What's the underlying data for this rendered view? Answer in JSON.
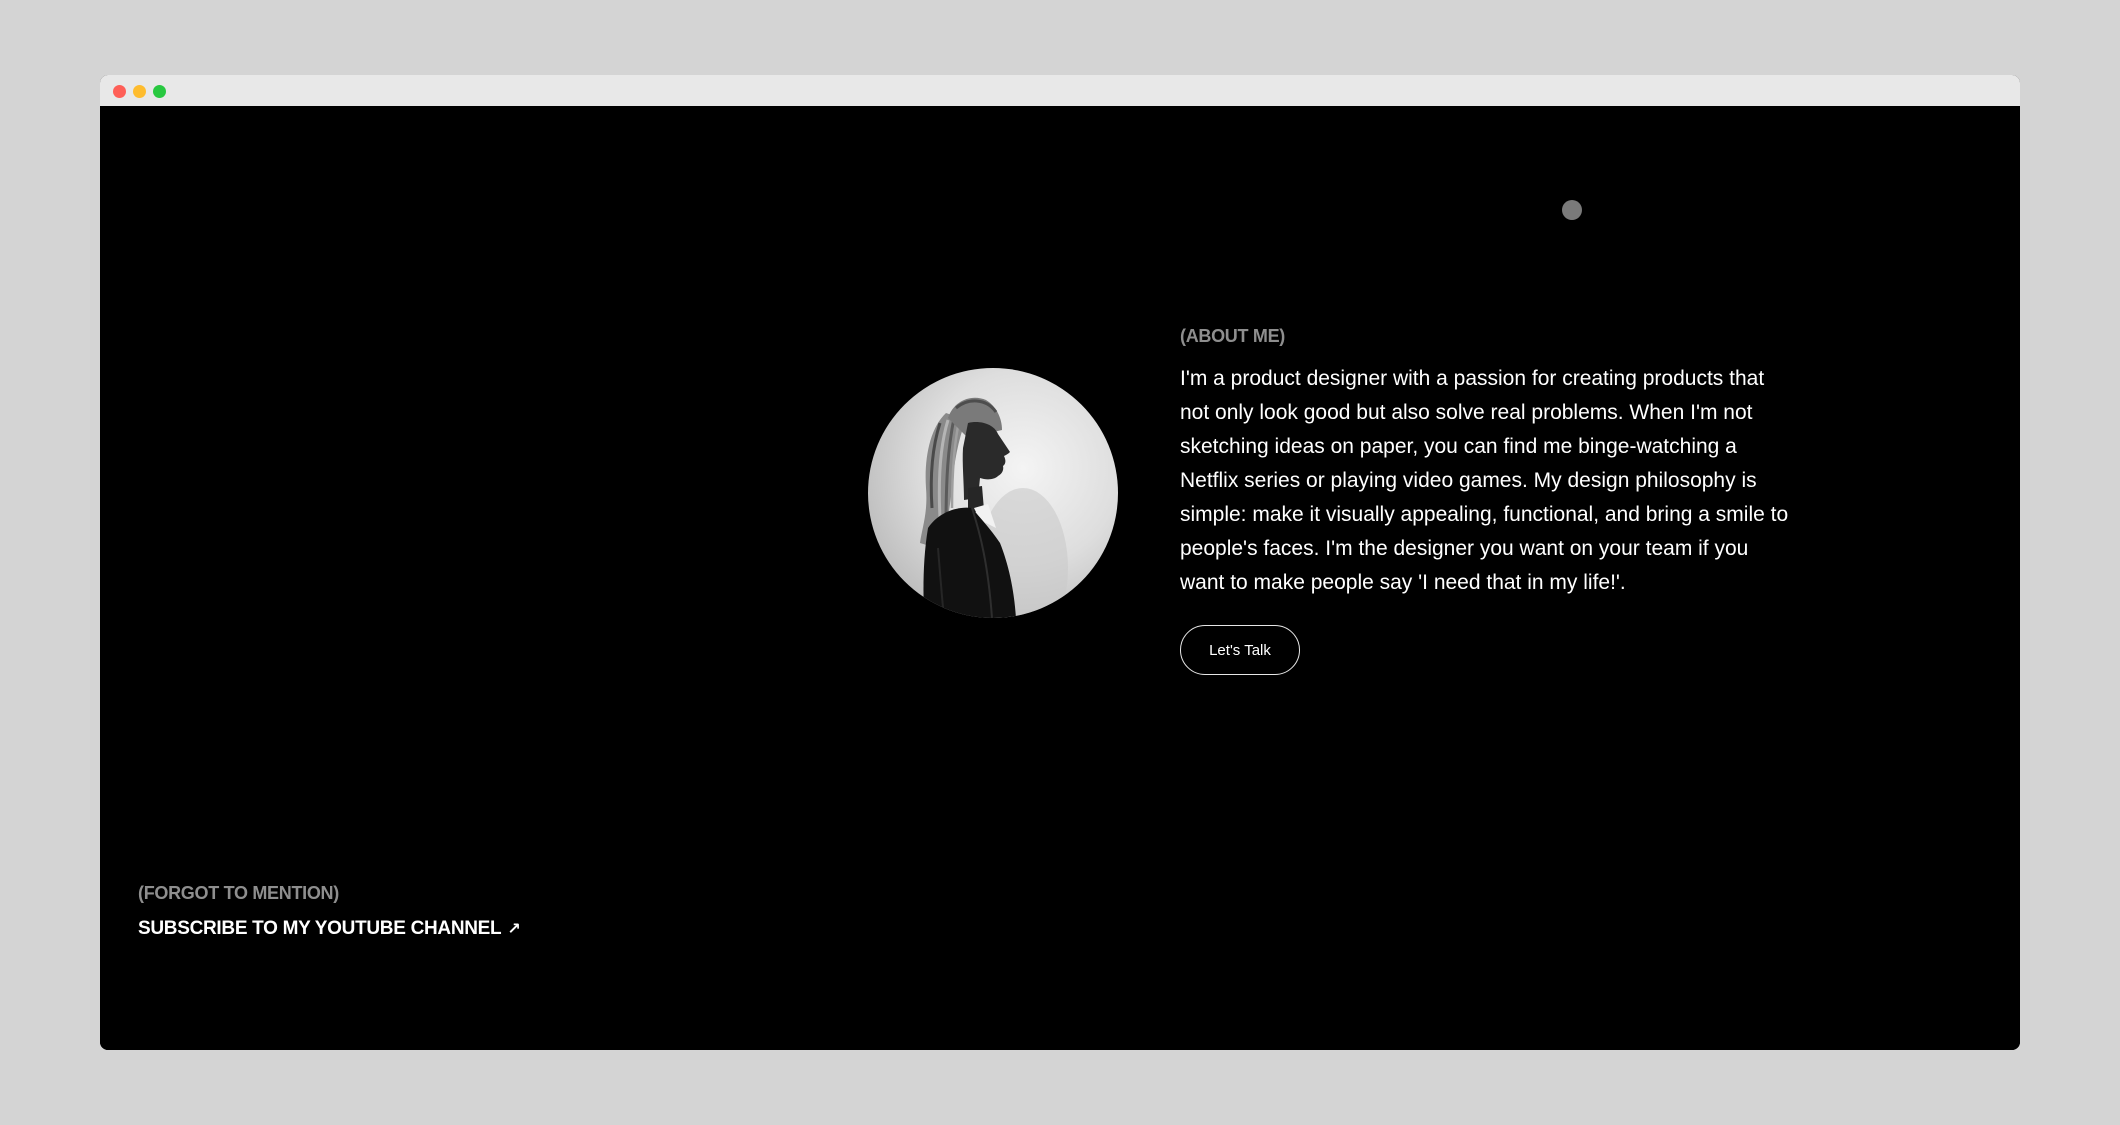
{
  "window": {
    "controls": [
      "close",
      "minimize",
      "maximize"
    ]
  },
  "about": {
    "label": "(ABOUT ME)",
    "text": "I'm a product designer with a passion for creating products that not only look good but also solve real problems. When I'm not sketching ideas on paper, you can find me binge-watching a Netflix series or playing video games. My design philosophy is simple: make it visually appealing, functional, and bring a smile to people's faces. I'm the designer you want on your team if you want to make people say 'I need that in my life!'.",
    "button_label": "Let's Talk"
  },
  "footer": {
    "label": "(FORGOT TO MENTION)",
    "link_text": "SUBSCRIBE TO MY YOUTUBE CHANNEL",
    "link_icon": "↗"
  },
  "icons": {
    "avatar": "profile-portrait-icon",
    "cursor": "cursor-dot-icon",
    "link": "arrow-up-right-icon"
  },
  "colors": {
    "background": "#000000",
    "text": "#ffffff",
    "muted": "#8e8e8e",
    "cursor": "#7a7a7a",
    "button_border": "#e6e6e6"
  }
}
